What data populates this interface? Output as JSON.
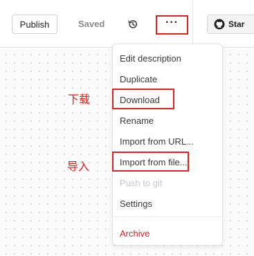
{
  "toolbar": {
    "publish_label": "Publish",
    "saved_label": "Saved",
    "more_label": "···",
    "star_label": "Star"
  },
  "menu": {
    "items": [
      {
        "label": "Edit description"
      },
      {
        "label": "Duplicate"
      },
      {
        "label": "Download"
      },
      {
        "label": "Rename"
      },
      {
        "label": "Import from URL..."
      },
      {
        "label": "Import from file..."
      },
      {
        "label": "Push to git",
        "disabled": true
      },
      {
        "label": "Settings"
      },
      {
        "label": "Archive",
        "danger": true
      }
    ]
  },
  "annotations": {
    "download_note": "下载",
    "import_note": "导入"
  },
  "colors": {
    "annotation_red": "#e0201b",
    "danger": "#d0242a",
    "disabled": "#c8c8c8"
  },
  "icons": [
    "history-icon",
    "more-horizontal-icon",
    "github-icon"
  ]
}
